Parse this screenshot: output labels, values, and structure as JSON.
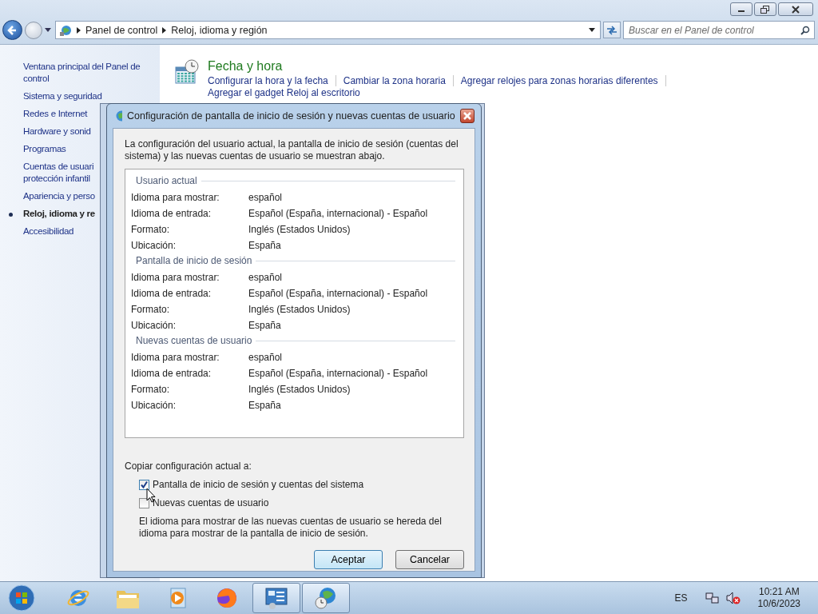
{
  "address_bar": {
    "breadcrumbs": [
      "Panel de control",
      "Reloj, idioma y región"
    ]
  },
  "search": {
    "placeholder": "Buscar en el Panel de control"
  },
  "sidebar": {
    "items": [
      {
        "lines": [
          "Ventana principal del Panel de",
          "control"
        ],
        "selected": false
      },
      {
        "lines": [
          "Sistema y seguridad"
        ],
        "selected": false
      },
      {
        "lines": [
          "Redes e Internet"
        ],
        "selected": false
      },
      {
        "lines": [
          "Hardware y sonid"
        ],
        "selected": false
      },
      {
        "lines": [
          "Programas"
        ],
        "selected": false
      },
      {
        "lines": [
          "Cuentas de usuari",
          "protección infantil"
        ],
        "selected": false
      },
      {
        "lines": [
          "Apariencia y perso"
        ],
        "selected": false
      },
      {
        "lines": [
          "Reloj, idioma y re"
        ],
        "selected": true
      },
      {
        "lines": [
          "Accesibilidad"
        ],
        "selected": false
      }
    ]
  },
  "category": {
    "title": "Fecha y hora",
    "links": [
      "Configurar la hora y la fecha",
      "Cambiar la zona horaria",
      "Agregar relojes para zonas horarias diferentes",
      "Agregar el gadget Reloj al escritorio"
    ]
  },
  "dialog": {
    "title": "Configuración de pantalla de inicio de sesión y nuevas cuentas de usuario",
    "intro": "La configuración del usuario actual, la pantalla de inicio de sesión (cuentas del sistema) y las nuevas cuentas de usuario se muestran abajo.",
    "groups": [
      {
        "heading": "Usuario actual",
        "rows": [
          {
            "label": "Idioma para mostrar:",
            "value": "español"
          },
          {
            "label": "Idioma de entrada:",
            "value": "Español (España, internacional) - Español"
          },
          {
            "label": "Formato:",
            "value": "Inglés (Estados Unidos)"
          },
          {
            "label": "Ubicación:",
            "value": "España"
          }
        ]
      },
      {
        "heading": "Pantalla de inicio de sesión",
        "rows": [
          {
            "label": "Idioma para mostrar:",
            "value": "español"
          },
          {
            "label": "Idioma de entrada:",
            "value": "Español (España, internacional) - Español"
          },
          {
            "label": "Formato:",
            "value": "Inglés (Estados Unidos)"
          },
          {
            "label": "Ubicación:",
            "value": "España"
          }
        ]
      },
      {
        "heading": "Nuevas cuentas de usuario",
        "rows": [
          {
            "label": "Idioma para mostrar:",
            "value": "español"
          },
          {
            "label": "Idioma de entrada:",
            "value": "Español (España, internacional) - Español"
          },
          {
            "label": "Formato:",
            "value": "Inglés (Estados Unidos)"
          },
          {
            "label": "Ubicación:",
            "value": "España"
          }
        ]
      }
    ],
    "copy_label": "Copiar configuración actual a:",
    "options": [
      {
        "label": "Pantalla de inicio de sesión y cuentas del sistema",
        "checked": true
      },
      {
        "label": "Nuevas cuentas de usuario",
        "checked": false
      }
    ],
    "note": "El idioma para mostrar de las nuevas cuentas de usuario se hereda del idioma para mostrar de la pantalla de inicio de sesión.",
    "buttons": [
      {
        "label": "Aceptar",
        "default": true
      },
      {
        "label": "Cancelar",
        "default": false
      }
    ]
  },
  "taskbar": {
    "apps": [
      {
        "kind": "browser",
        "open": false
      },
      {
        "kind": "folder",
        "open": false
      },
      {
        "kind": "media",
        "open": false
      },
      {
        "kind": "fox",
        "open": false
      },
      {
        "kind": "control",
        "open": true
      },
      {
        "kind": "region",
        "open": true
      }
    ],
    "language": "ES",
    "time": "10:21 AM",
    "date": "10/6/2023"
  }
}
